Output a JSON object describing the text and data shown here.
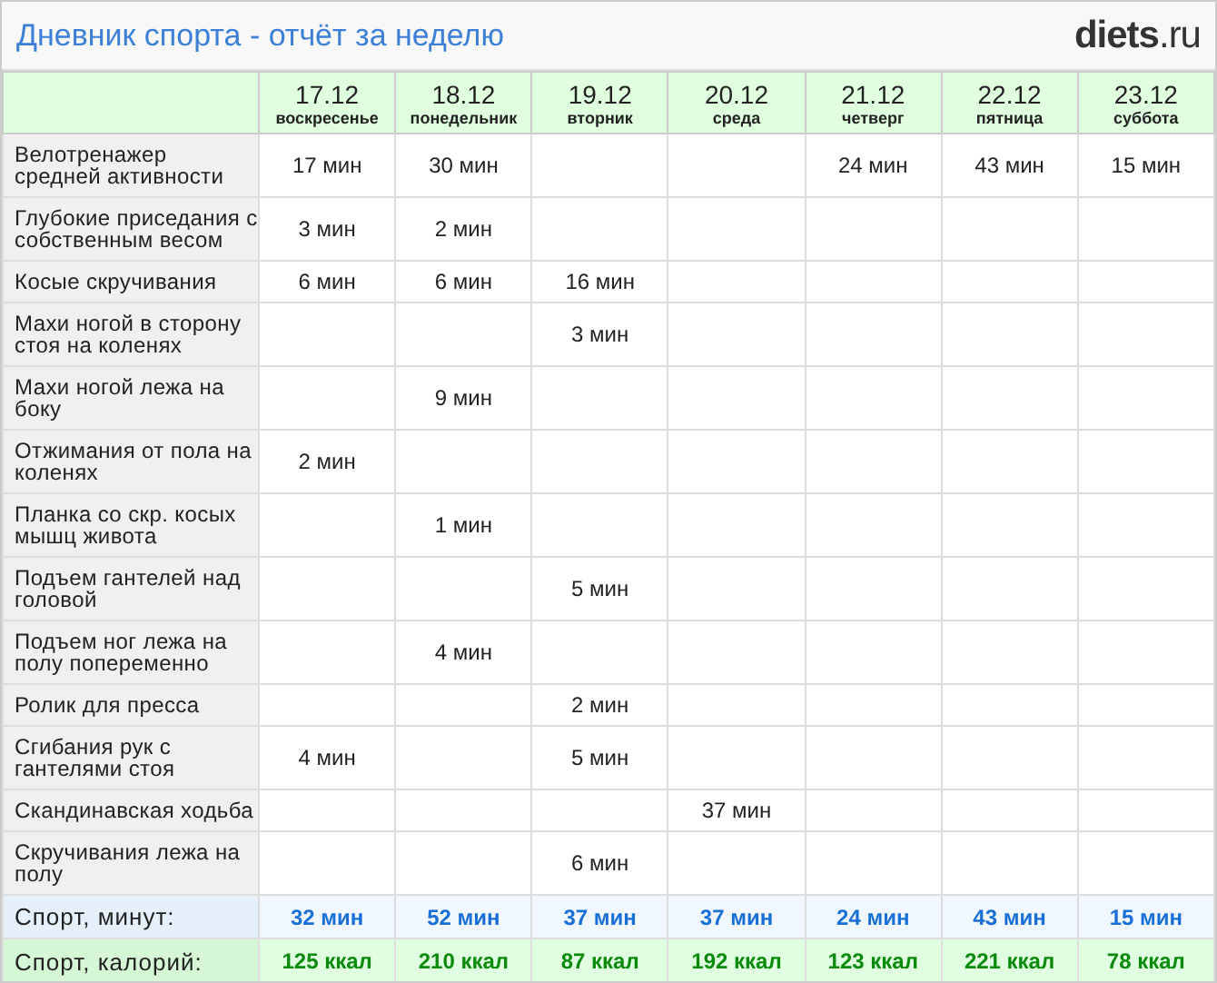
{
  "title": "Дневник спорта - отчёт за неделю",
  "logo": {
    "name": "diets",
    "domain": ".ru"
  },
  "days": [
    {
      "date": "17.12",
      "weekday": "воскресенье"
    },
    {
      "date": "18.12",
      "weekday": "понедельник"
    },
    {
      "date": "19.12",
      "weekday": "вторник"
    },
    {
      "date": "20.12",
      "weekday": "среда"
    },
    {
      "date": "21.12",
      "weekday": "четверг"
    },
    {
      "date": "22.12",
      "weekday": "пятница"
    },
    {
      "date": "23.12",
      "weekday": "суббота"
    }
  ],
  "rows": [
    {
      "exercise": "Велотренажер средней активности",
      "cells": [
        "17 мин",
        "30 мин",
        null,
        null,
        "24 мин",
        "43 мин",
        "15 мин"
      ]
    },
    {
      "exercise": "Глубокие приседания с собственным весом",
      "cells": [
        "3 мин",
        "2 мин",
        null,
        null,
        null,
        null,
        null
      ]
    },
    {
      "exercise": "Косые скручивания",
      "cells": [
        "6 мин",
        "6 мин",
        "16 мин",
        null,
        null,
        null,
        null
      ]
    },
    {
      "exercise": "Махи ногой в сторону стоя на коленях",
      "cells": [
        null,
        null,
        "3 мин",
        null,
        null,
        null,
        null
      ]
    },
    {
      "exercise": "Махи ногой лежа на боку",
      "cells": [
        null,
        "9 мин",
        null,
        null,
        null,
        null,
        null
      ]
    },
    {
      "exercise": "Отжимания от пола на коленях",
      "cells": [
        "2 мин",
        null,
        null,
        null,
        null,
        null,
        null
      ]
    },
    {
      "exercise": "Планка со скр. косых мышц живота",
      "cells": [
        null,
        "1 мин",
        null,
        null,
        null,
        null,
        null
      ]
    },
    {
      "exercise": "Подъем гантелей над головой",
      "cells": [
        null,
        null,
        "5 мин",
        null,
        null,
        null,
        null
      ]
    },
    {
      "exercise": "Подъем ног лежа на полу попеременно",
      "cells": [
        null,
        "4 мин",
        null,
        null,
        null,
        null,
        null
      ]
    },
    {
      "exercise": "Ролик для пресса",
      "cells": [
        null,
        null,
        "2 мин",
        null,
        null,
        null,
        null
      ]
    },
    {
      "exercise": "Сгибания рук с гантелями стоя",
      "cells": [
        "4 мин",
        null,
        "5 мин",
        null,
        null,
        null,
        null
      ]
    },
    {
      "exercise": "Скандинавская ходьба",
      "cells": [
        null,
        null,
        null,
        "37 мин",
        null,
        null,
        null
      ]
    },
    {
      "exercise": "Скручивания лежа на полу",
      "cells": [
        null,
        null,
        "6 мин",
        null,
        null,
        null,
        null
      ]
    }
  ],
  "totals": [
    {
      "kind": "minutes",
      "label": "Спорт, минут:",
      "values": [
        "32 мин",
        "52 мин",
        "37 мин",
        "37 мин",
        "24 мин",
        "43 мин",
        "15 мин"
      ]
    },
    {
      "kind": "calories",
      "label": "Спорт, калорий:",
      "values": [
        "125 ккал",
        "210 ккал",
        "87 ккал",
        "192 ккал",
        "123 ккал",
        "221 ккал",
        "78 ккал"
      ]
    }
  ]
}
